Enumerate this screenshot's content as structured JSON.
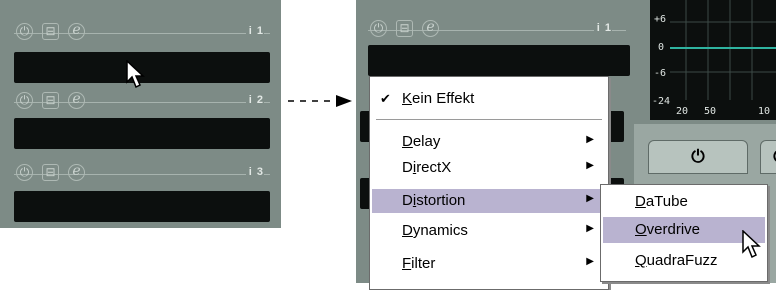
{
  "left_panel": {
    "slots": [
      {
        "index_label": "i 1"
      },
      {
        "index_label": "i 2"
      },
      {
        "index_label": "i 3"
      }
    ]
  },
  "right_panel": {
    "slot": {
      "index_label": "i 1"
    },
    "graph": {
      "y_ticks": [
        "+6",
        "0",
        "-6",
        "-24"
      ],
      "x_ticks": [
        "20",
        "50",
        "10"
      ]
    }
  },
  "icons": {
    "power": "⏻",
    "archive": "⊟",
    "edit": "e"
  },
  "menu": {
    "check_mark": "✔",
    "items": [
      {
        "prefix": "",
        "accel": "K",
        "rest": "ein Effekt",
        "checked": true,
        "submenu": false
      },
      {
        "prefix": "",
        "accel": "D",
        "rest": "elay",
        "checked": false,
        "submenu": true
      },
      {
        "prefix": "D",
        "accel": "i",
        "rest": "rectX",
        "checked": false,
        "submenu": true
      },
      {
        "prefix": "D",
        "accel": "i",
        "rest": "stortion",
        "checked": false,
        "submenu": true,
        "selected": true
      },
      {
        "prefix": "",
        "accel": "D",
        "rest": "ynamics",
        "checked": false,
        "submenu": true
      },
      {
        "prefix": "",
        "accel": "F",
        "rest": "ilter",
        "checked": false,
        "submenu": true
      }
    ],
    "submenu_arrow": "▶"
  },
  "submenu": {
    "items": [
      {
        "accel": "D",
        "rest": "aTube"
      },
      {
        "accel": "O",
        "rest": "verdrive",
        "selected": true
      },
      {
        "accel": "Q",
        "rest": "uadraFuzz"
      }
    ]
  },
  "colors": {
    "panel": "#7d8b86",
    "slot_bar": "#0c0f0e",
    "selection": "#b9b3d0",
    "graph_line": "#2fb3a0"
  }
}
